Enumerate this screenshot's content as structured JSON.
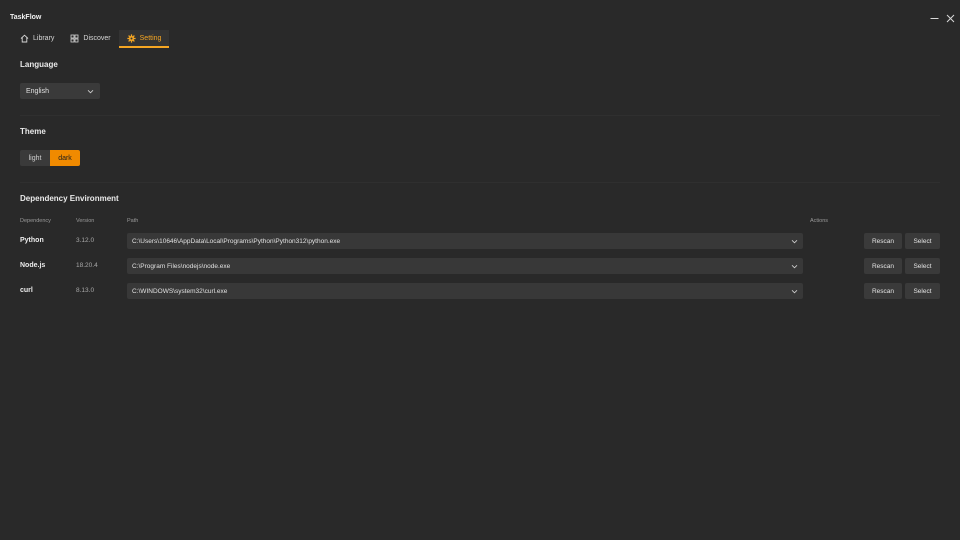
{
  "app": {
    "title": "TaskFlow"
  },
  "tabs": [
    {
      "label": "Library",
      "icon": "home-icon"
    },
    {
      "label": "Discover",
      "icon": "grid-icon"
    },
    {
      "label": "Setting",
      "icon": "gear-icon",
      "active": true
    }
  ],
  "language": {
    "title": "Language",
    "selected": "English"
  },
  "theme": {
    "title": "Theme",
    "options": [
      "light",
      "dark"
    ],
    "selected": "dark"
  },
  "dependencies": {
    "title": "Dependency Environment",
    "columns": [
      "Dependency",
      "Version",
      "Path",
      "Actions"
    ],
    "rows": [
      {
        "name": "Python",
        "version": "3.12.0",
        "path": "C:\\Users\\10646\\AppData\\Local\\Programs\\Python\\Python312\\python.exe",
        "rescan": "Rescan",
        "select": "Select"
      },
      {
        "name": "Node.js",
        "version": "18.20.4",
        "path": "C:\\Program Files\\nodejs\\node.exe",
        "rescan": "Rescan",
        "select": "Select"
      },
      {
        "name": "curl",
        "version": "8.13.0",
        "path": "C:\\WINDOWS\\system32\\curl.exe",
        "rescan": "Rescan",
        "select": "Select"
      }
    ]
  },
  "colors": {
    "background": "#292929",
    "accent": "#f5a623",
    "accent_active_toggle": "#f08a00",
    "control": "#3a3a3a"
  }
}
